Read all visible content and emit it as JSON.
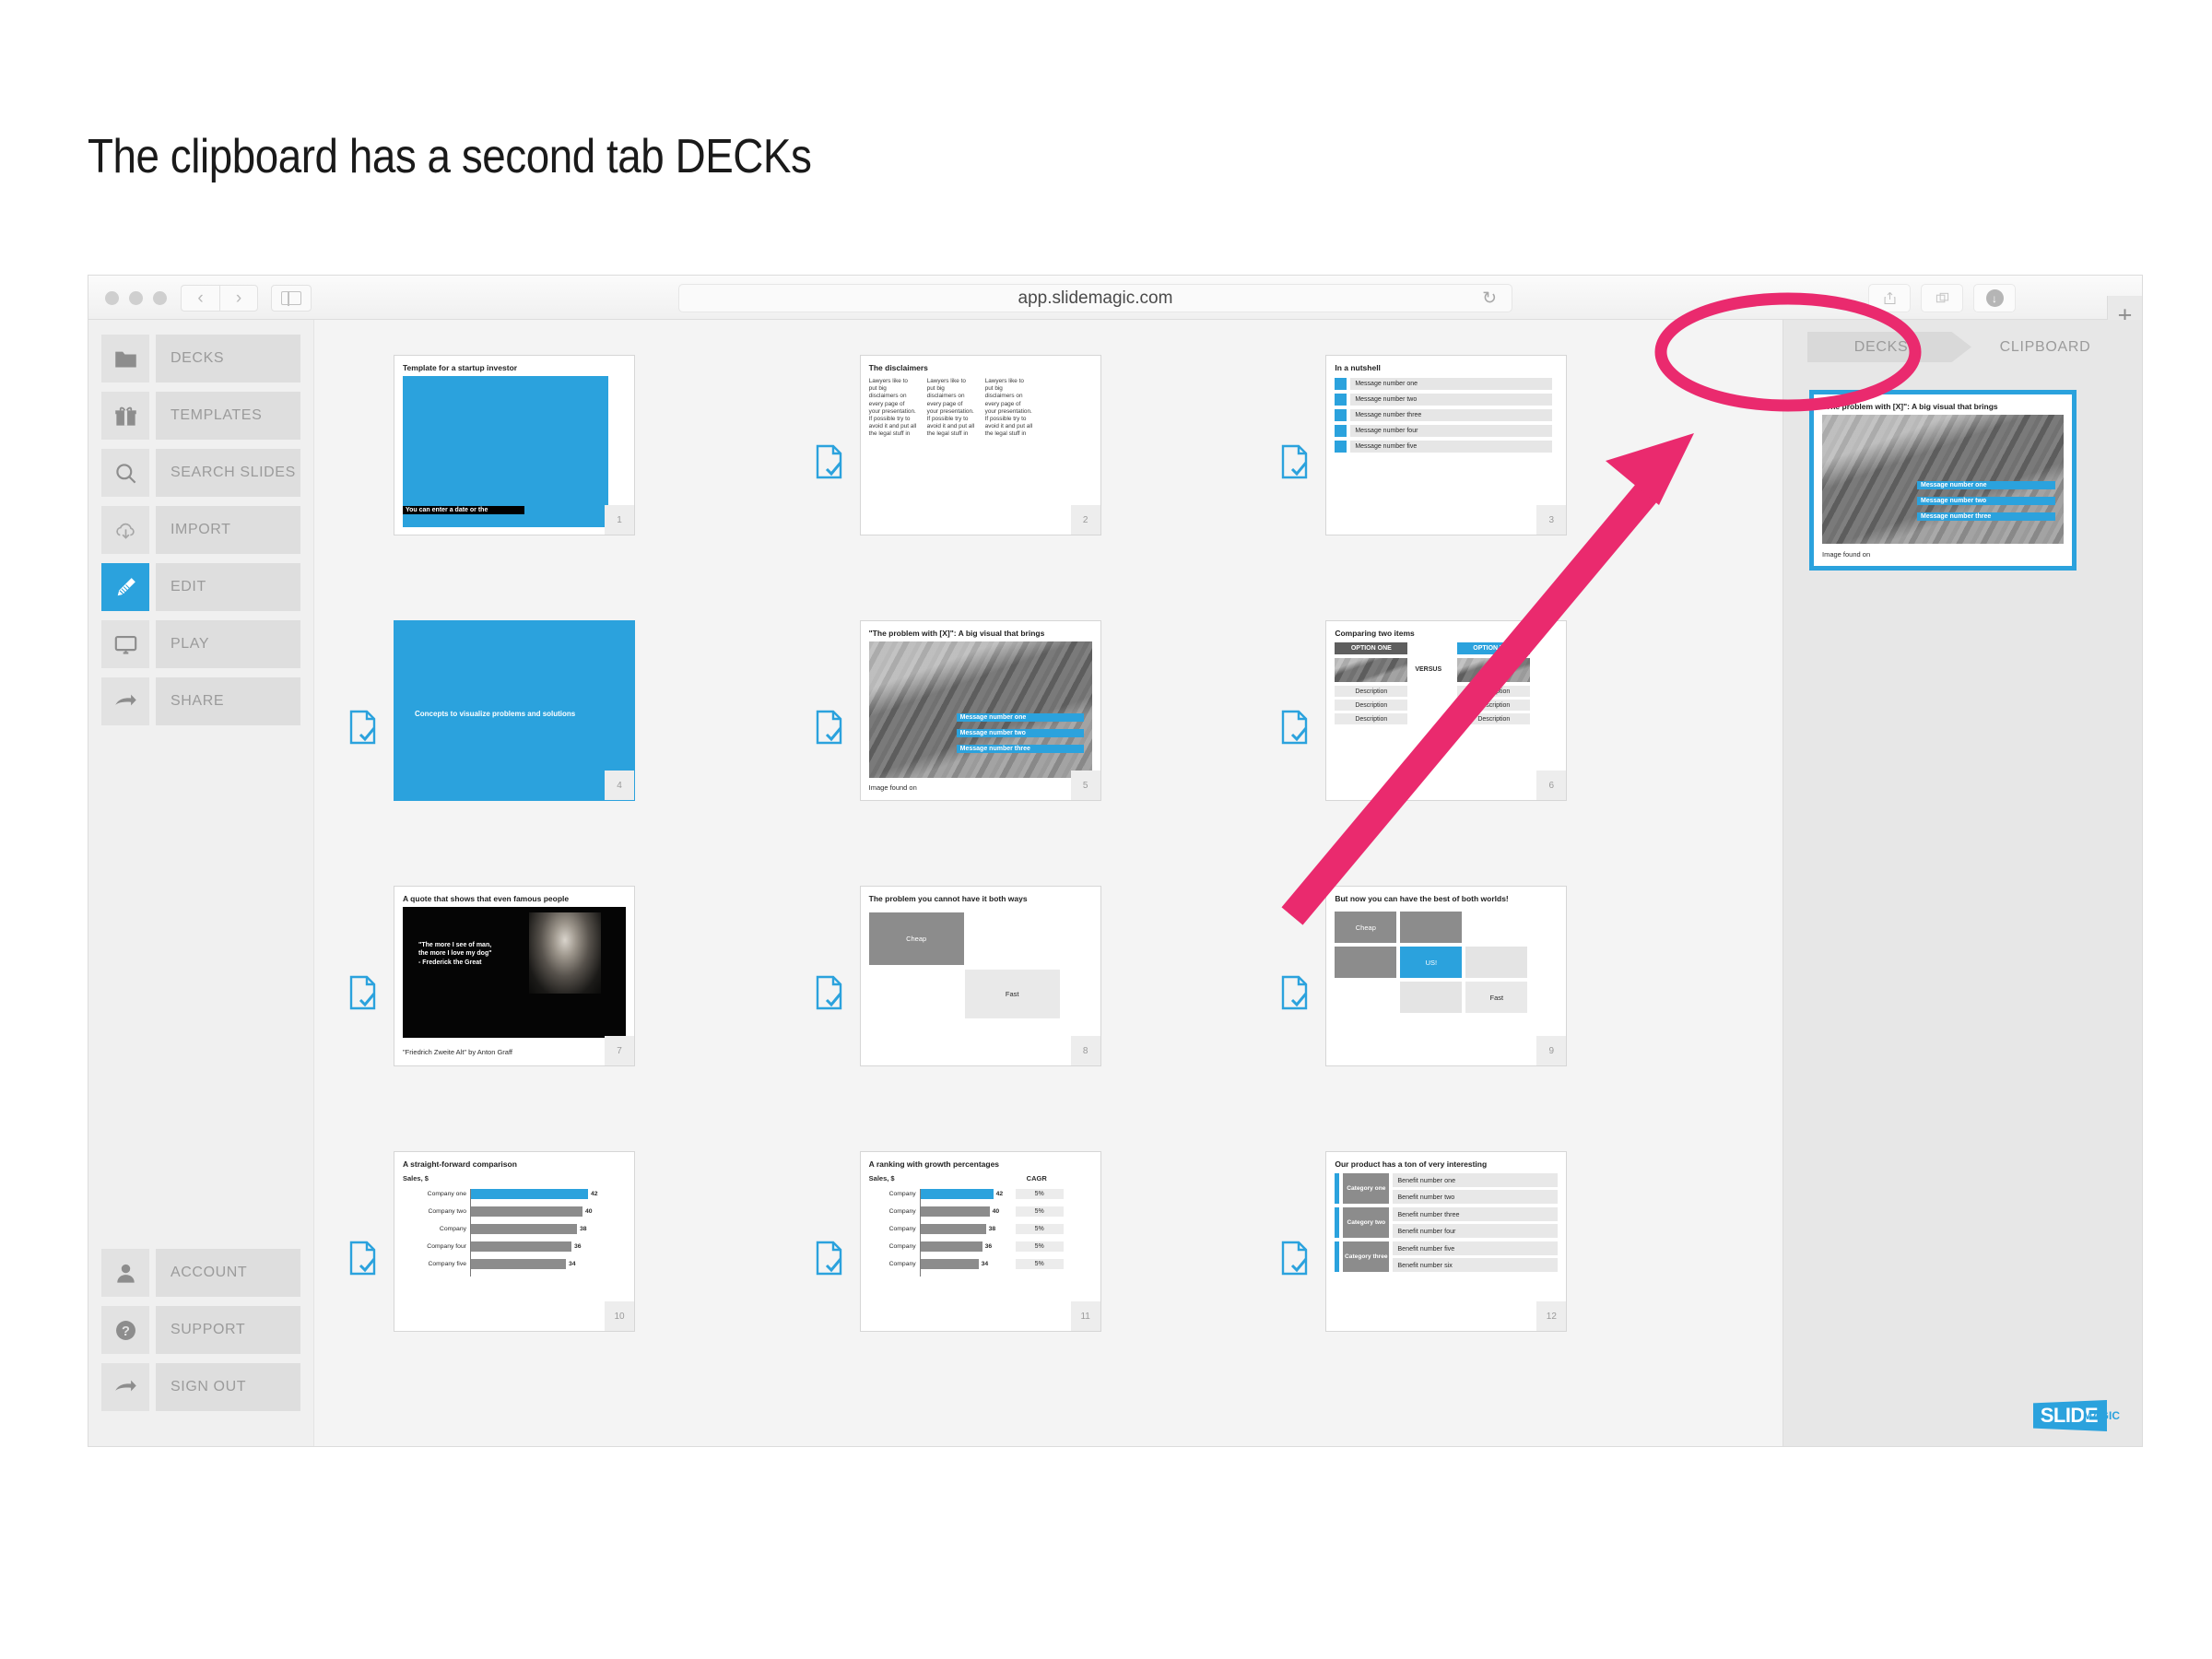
{
  "page": {
    "title": "The clipboard has a second tab DECKs"
  },
  "browser": {
    "url": "app.slidemagic.com",
    "reload_icon": "reload-icon",
    "back_icon": "chevron-left-icon",
    "forward_icon": "chevron-right-icon",
    "sidebar_icon": "sidebar-toggle-icon",
    "share_icon": "share-icon",
    "tabs_icon": "tab-overview-icon",
    "downloads_icon": "downloads-icon",
    "new_tab_label": "+"
  },
  "sidebar": {
    "items": [
      {
        "label": "DECKS",
        "icon": "folder-icon",
        "active": false
      },
      {
        "label": "TEMPLATES",
        "icon": "gift-icon",
        "active": false
      },
      {
        "label": "SEARCH SLIDES",
        "icon": "search-icon",
        "active": false
      },
      {
        "label": "IMPORT",
        "icon": "cloud-download-icon",
        "active": false
      },
      {
        "label": "EDIT",
        "icon": "pencil-icon",
        "active": true
      },
      {
        "label": "PLAY",
        "icon": "monitor-icon",
        "active": false
      },
      {
        "label": "SHARE",
        "icon": "arrow-share-icon",
        "active": false
      }
    ],
    "bottom_items": [
      {
        "label": "ACCOUNT",
        "icon": "user-icon"
      },
      {
        "label": "SUPPORT",
        "icon": "question-circle-icon"
      },
      {
        "label": "SIGN OUT",
        "icon": "arrow-share-icon"
      }
    ]
  },
  "right_panel": {
    "tabs": [
      {
        "label": "DECKS",
        "active": true
      },
      {
        "label": "CLIPBOARD",
        "active": false
      }
    ],
    "clipboard_slide": {
      "title": "\"The problem with [X]\": A big visual that brings",
      "overlays": [
        "Message number one",
        "Message number two",
        "Message number three"
      ],
      "caption": "Image found on",
      "page": ""
    },
    "logo": {
      "part1": "SLIDE",
      "part2": "MAGIC"
    }
  },
  "slides": [
    {
      "num": "1",
      "type": "title-blue",
      "title": "Template for a startup investor",
      "caption": "You can enter a date or the"
    },
    {
      "num": "2",
      "type": "three-columns",
      "title": "The disclaimers",
      "columns": [
        "Lawyers like to put big disclaimers on every page of your presentation. If possible try to avoid it and put all the legal stuff in",
        "Lawyers like to put big disclaimers on every page of your presentation. If possible try to avoid it and put all the legal stuff in",
        "Lawyers like to put big disclaimers on every page of your presentation. If possible try to avoid it and put all the legal stuff in"
      ]
    },
    {
      "num": "3",
      "type": "message-list",
      "title": "In a nutshell",
      "messages": [
        "Message number one",
        "Message number two",
        "Message number three",
        "Message number four",
        "Message number five"
      ]
    },
    {
      "num": "4",
      "type": "full-blue",
      "title": "Concepts to visualize problems and solutions"
    },
    {
      "num": "5",
      "type": "photo-overlay",
      "title": "\"The problem with [X]\": A big visual that brings",
      "overlays": [
        "Message number one",
        "Message number two",
        "Message number three"
      ],
      "caption": "Image found on"
    },
    {
      "num": "6",
      "type": "versus",
      "title": "Comparing two items",
      "option_one": "OPTION ONE",
      "option_two": "OPTION TWO",
      "versus": "VERSUS",
      "descriptions": [
        "Description",
        "Description",
        "Description"
      ]
    },
    {
      "num": "7",
      "type": "quote",
      "title": "A quote that shows that even famous people",
      "quote": "\"The more I see of man,\nthe more I love my dog\"\n- Frederick the Great",
      "caption": "\"Friedrich Zweite Alt\" by Anton Graff"
    },
    {
      "num": "8",
      "type": "tradeoff",
      "title": "The problem you cannot have it both ways",
      "box_one": "Cheap",
      "box_two": "Fast"
    },
    {
      "num": "9",
      "type": "best-both",
      "title": "But now you can have the best of both worlds!",
      "box_one": "Cheap",
      "box_us": "US!",
      "box_two": "Fast"
    },
    {
      "num": "10",
      "type": "bar-chart",
      "title": "A straight-forward comparison",
      "ylabel": "Sales, $",
      "categories": [
        "Company one",
        "Company two",
        "Company",
        "Company four",
        "Company five"
      ],
      "values": [
        42,
        40,
        38,
        36,
        34
      ]
    },
    {
      "num": "11",
      "type": "bar-chart-cagr",
      "title": "A ranking with growth percentages",
      "ylabel": "Sales, $",
      "cagr_header": "CAGR",
      "categories": [
        "Company",
        "Company",
        "Company",
        "Company",
        "Company"
      ],
      "values": [
        42,
        40,
        38,
        36,
        34
      ],
      "cagr": [
        "5%",
        "5%",
        "5%",
        "5%",
        "5%"
      ]
    },
    {
      "num": "12",
      "type": "categories-benefits",
      "title": "Our product has a ton of very interesting",
      "categories": [
        "Category one",
        "Category two",
        "Category three"
      ],
      "benefits": [
        "Benefit number one",
        "Benefit number two",
        "Benefit number three",
        "Benefit number four",
        "Benefit number five",
        "Benefit number six"
      ]
    }
  ],
  "chart_data": [
    {
      "type": "bar",
      "title": "A straight-forward comparison",
      "ylabel": "Sales, $",
      "xlabel": "",
      "categories": [
        "Company one",
        "Company two",
        "Company",
        "Company four",
        "Company five"
      ],
      "values": [
        42,
        40,
        38,
        36,
        34
      ],
      "xlim": [
        0,
        46
      ],
      "highlight_index": 0,
      "highlight_color": "#2ba2dd",
      "bar_color": "#8c8c8c",
      "grid": false,
      "legend": "none"
    },
    {
      "type": "bar",
      "title": "A ranking with growth percentages",
      "ylabel": "Sales, $",
      "xlabel": "",
      "categories": [
        "Company",
        "Company",
        "Company",
        "Company",
        "Company"
      ],
      "values": [
        42,
        40,
        38,
        36,
        34
      ],
      "extra_column": {
        "header": "CAGR",
        "values": [
          "5%",
          "5%",
          "5%",
          "5%",
          "5%"
        ]
      },
      "xlim": [
        0,
        46
      ],
      "highlight_index": 0,
      "highlight_color": "#2ba2dd",
      "bar_color": "#8c8c8c",
      "grid": false,
      "legend": "none"
    }
  ],
  "annotation": {
    "arrow_color": "#ea2a6e",
    "ellipse_color": "#ea2a6e"
  },
  "colors": {
    "accent": "#2ba2dd",
    "grey": "#8c8c8c",
    "light_grey": "#e4e4e4",
    "pink": "#ea2a6e"
  }
}
